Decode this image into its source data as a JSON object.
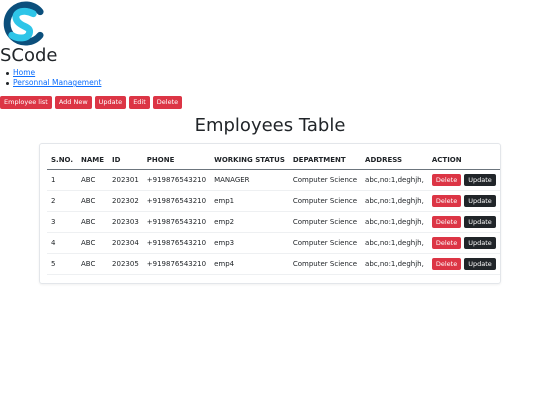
{
  "brand": {
    "name": "SCode",
    "logo_icon": "scode-logo-icon"
  },
  "nav_links": [
    {
      "label": "Home"
    },
    {
      "label": "Personnal Management"
    }
  ],
  "toolbar": [
    {
      "label": "Employee list"
    },
    {
      "label": "Add New"
    },
    {
      "label": "Update"
    },
    {
      "label": "Edit"
    },
    {
      "label": "Delete"
    }
  ],
  "table_title": "Employees Table",
  "columns": [
    "S.NO.",
    "NAME",
    "ID",
    "PHONE",
    "WORKING STATUS",
    "DEPARTMENT",
    "ADDRESS",
    "ACTION"
  ],
  "rows": [
    {
      "sno": "1",
      "name": "ABC",
      "id": "202301",
      "phone": "+919876543210",
      "status": "MANAGER",
      "department": "Computer Science",
      "address": "abc,no:1,deghjh,"
    },
    {
      "sno": "2",
      "name": "ABC",
      "id": "202302",
      "phone": "+919876543210",
      "status": "emp1",
      "department": "Computer Science",
      "address": "abc,no:1,deghjh,"
    },
    {
      "sno": "3",
      "name": "ABC",
      "id": "202303",
      "phone": "+919876543210",
      "status": "emp2",
      "department": "Computer Science",
      "address": "abc,no:1,deghjh,"
    },
    {
      "sno": "4",
      "name": "ABC",
      "id": "202304",
      "phone": "+919876543210",
      "status": "emp3",
      "department": "Computer Science",
      "address": "abc,no:1,deghjh,"
    },
    {
      "sno": "5",
      "name": "ABC",
      "id": "202305",
      "phone": "+919876543210",
      "status": "emp4",
      "department": "Computer Science",
      "address": "abc,no:1,deghjh,"
    }
  ],
  "row_actions": {
    "delete_label": "Delete",
    "update_label": "Update"
  },
  "colors": {
    "danger": "#dc3545",
    "dark": "#212529",
    "link": "#0d6efd",
    "logo_light": "#2ec5e8",
    "logo_dark": "#0b4f7c"
  }
}
